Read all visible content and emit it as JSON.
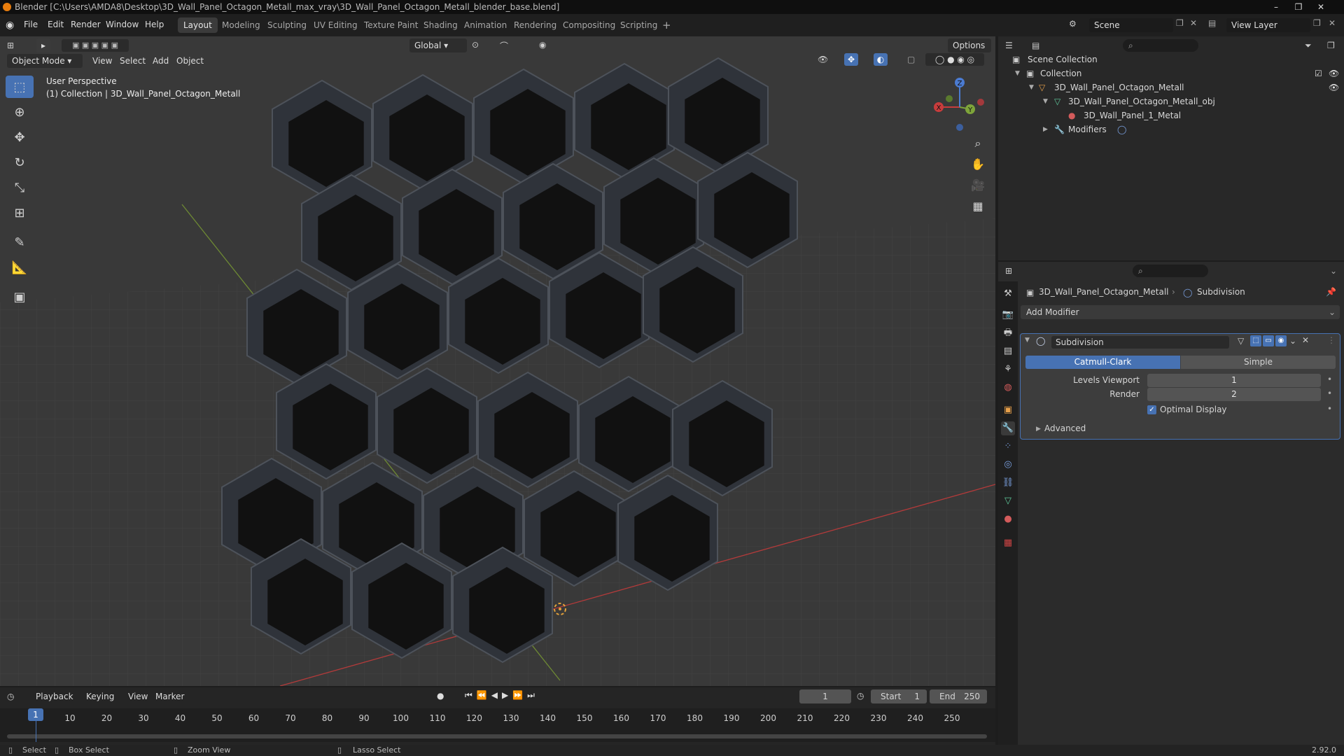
{
  "window": {
    "title": "Blender [C:\\Users\\AMDA8\\Desktop\\3D_Wall_Panel_Octagon_Metall_max_vray\\3D_Wall_Panel_Octagon_Metall_blender_base.blend]",
    "controls": [
      "–",
      "❐",
      "✕"
    ]
  },
  "menu": [
    "File",
    "Edit",
    "Render",
    "Window",
    "Help"
  ],
  "workspaces": [
    "Layout",
    "Modeling",
    "Sculpting",
    "UV Editing",
    "Texture Paint",
    "Shading",
    "Animation",
    "Rendering",
    "Compositing",
    "Scripting"
  ],
  "active_workspace": "Layout",
  "scene": {
    "label": "Scene",
    "view_layer": "View Layer"
  },
  "viewport": {
    "mode": "Object Mode",
    "menus": [
      "View",
      "Select",
      "Add",
      "Object"
    ],
    "orientation": "Global",
    "options_label": "Options",
    "overlay_line1": "User Perspective",
    "overlay_line2": "(1) Collection | 3D_Wall_Panel_Octagon_Metall",
    "gizmo": {
      "x": "X",
      "y": "Y",
      "z": "Z"
    }
  },
  "outliner": {
    "root": "Scene Collection",
    "rows": [
      {
        "label": "Collection"
      },
      {
        "label": "3D_Wall_Panel_Octagon_Metall"
      },
      {
        "label": "3D_Wall_Panel_Octagon_Metall_obj"
      },
      {
        "label": "3D_Wall_Panel_1_Metal"
      },
      {
        "label": "Modifiers"
      }
    ]
  },
  "properties": {
    "object_name": "3D_Wall_Panel_Octagon_Metall",
    "modifier_breadcrumb": "Subdivision",
    "add_modifier": "Add Modifier",
    "modifier": {
      "name": "Subdivision",
      "type_options": [
        "Catmull-Clark",
        "Simple"
      ],
      "selected_type": "Catmull-Clark",
      "levels_viewport_label": "Levels Viewport",
      "levels_viewport": "1",
      "render_label": "Render",
      "render": "2",
      "optimal_display_label": "Optimal Display",
      "optimal_display": true,
      "advanced_label": "Advanced"
    }
  },
  "timeline": {
    "menus": [
      "Playback",
      "Keying",
      "View",
      "Marker"
    ],
    "current_frame": "1",
    "start_label": "Start",
    "start": "1",
    "end_label": "End",
    "end": "250",
    "ticks": [
      "10",
      "20",
      "30",
      "40",
      "50",
      "60",
      "70",
      "80",
      "90",
      "100",
      "110",
      "120",
      "130",
      "140",
      "150",
      "160",
      "170",
      "180",
      "190",
      "200",
      "210",
      "220",
      "230",
      "240",
      "250"
    ],
    "cursor_label": "1"
  },
  "statusbar": {
    "items": [
      "Select",
      "Box Select",
      "Zoom View",
      "Lasso Select"
    ],
    "version": "2.92.0"
  },
  "colors": {
    "accent": "#4772b3",
    "brand": "#e87d0d",
    "x_axis": "#c83c3c",
    "y_axis": "#7ea43a"
  }
}
